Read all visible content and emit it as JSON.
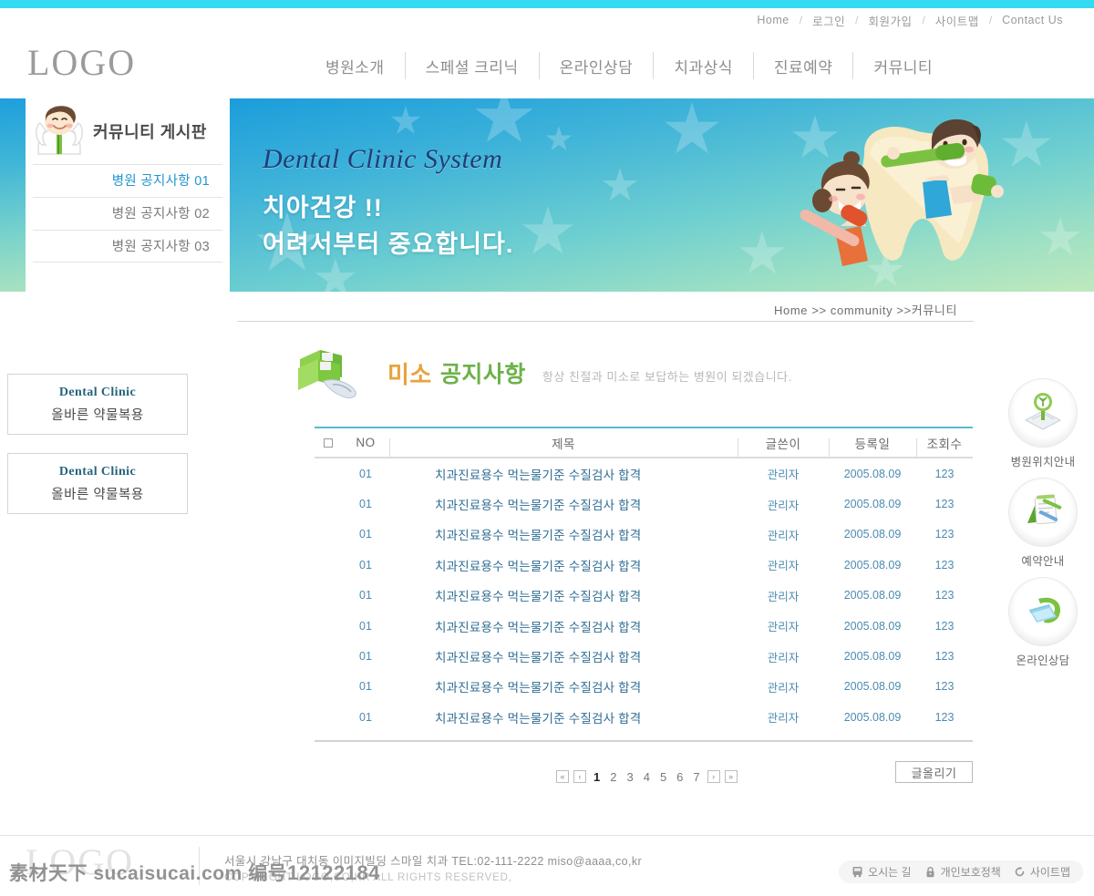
{
  "colors": {
    "top_bar": "#34dbf0",
    "accent_blue": "#2196cf",
    "banner_title": "#1f3d77",
    "title_orange": "#e8a33d",
    "title_green": "#6cb24a",
    "row_text": "#2f6d93"
  },
  "util_nav": {
    "items": [
      "Home",
      "로그인",
      "회원가입",
      "사이트맵",
      "Contact Us"
    ],
    "separator": "/"
  },
  "header": {
    "logo": "LOGO",
    "menu": [
      "병원소개",
      "스페셜 크리닉",
      "온라인상담",
      "치과상식",
      "진료예약",
      "커뮤니티"
    ]
  },
  "banner": {
    "title": "Dental Clinic System",
    "line1": "치아건강  !!",
    "line2": "어려서부터  중요합니다."
  },
  "sidebar": {
    "title": "커뮤니티 게시판",
    "items": [
      {
        "label": "병원 공지사항 01",
        "active": true
      },
      {
        "label": "병원 공지사항 02",
        "active": false
      },
      {
        "label": "병원 공지사항 03",
        "active": false
      }
    ],
    "promos": [
      {
        "en": "Dental Clinic",
        "kr": "올바른 약물복용"
      },
      {
        "en": "Dental Clinic",
        "kr": "올바른 약물복용"
      }
    ]
  },
  "breadcrumb": "Home >> community >>커뮤니티",
  "content": {
    "title_highlight": "미소",
    "title_main": "공지사항",
    "subtitle": "항상 친절과 미소로 보답하는 병원이 되겠습니다."
  },
  "board": {
    "headers": {
      "checkbox": "",
      "no": "NO",
      "title": "제목",
      "writer": "글쓴이",
      "date": "등록일",
      "hits": "조회수"
    },
    "rows": [
      {
        "no": "01",
        "title": "치과진료용수 먹는물기준 수질검사 합격",
        "writer": "관리자",
        "date": "2005.08.09",
        "hits": "123"
      },
      {
        "no": "01",
        "title": "치과진료용수 먹는물기준 수질검사 합격",
        "writer": "관리자",
        "date": "2005.08.09",
        "hits": "123"
      },
      {
        "no": "01",
        "title": "치과진료용수 먹는물기준 수질검사 합격",
        "writer": "관리자",
        "date": "2005.08.09",
        "hits": "123"
      },
      {
        "no": "01",
        "title": "치과진료용수 먹는물기준 수질검사 합격",
        "writer": "관리자",
        "date": "2005.08.09",
        "hits": "123"
      },
      {
        "no": "01",
        "title": "치과진료용수 먹는물기준 수질검사 합격",
        "writer": "관리자",
        "date": "2005.08.09",
        "hits": "123"
      },
      {
        "no": "01",
        "title": "치과진료용수 먹는물기준 수질검사 합격",
        "writer": "관리자",
        "date": "2005.08.09",
        "hits": "123"
      },
      {
        "no": "01",
        "title": "치과진료용수 먹는물기준 수질검사 합격",
        "writer": "관리자",
        "date": "2005.08.09",
        "hits": "123"
      },
      {
        "no": "01",
        "title": "치과진료용수 먹는물기준 수질검사 합격",
        "writer": "관리자",
        "date": "2005.08.09",
        "hits": "123"
      },
      {
        "no": "01",
        "title": "치과진료용수 먹는물기준 수질검사 합격",
        "writer": "관리자",
        "date": "2005.08.09",
        "hits": "123"
      }
    ]
  },
  "pagination": {
    "first": "«",
    "prev": "‹",
    "pages": [
      "1",
      "2",
      "3",
      "4",
      "5",
      "6",
      "7"
    ],
    "current": "1",
    "next": "›",
    "last": "»",
    "write_button": "글올리기"
  },
  "quick_menu": [
    {
      "label": "병원위치안내",
      "icon": "map-pin-icon"
    },
    {
      "label": "예약안내",
      "icon": "notepad-icon"
    },
    {
      "label": "온라인상담",
      "icon": "monitor-icon"
    }
  ],
  "footer": {
    "logo": "LOGO",
    "address": "서울시 강남구 대치동 이미지빌딩 스마일 치과    TEL:02-111-2222   miso@aaaa,co,kr",
    "copyright": "COPYRIGHT LOGO,CO,KR    ALL RIGHTS RESERVED,",
    "links": [
      {
        "label": "오시는 길",
        "icon": "bus-icon"
      },
      {
        "label": "개인보호정책",
        "icon": "lock-icon"
      },
      {
        "label": "사이트맵",
        "icon": "refresh-icon"
      }
    ]
  },
  "watermark": {
    "text": "素材天下 sucaisucai.com 编号",
    "number": "12122184"
  }
}
